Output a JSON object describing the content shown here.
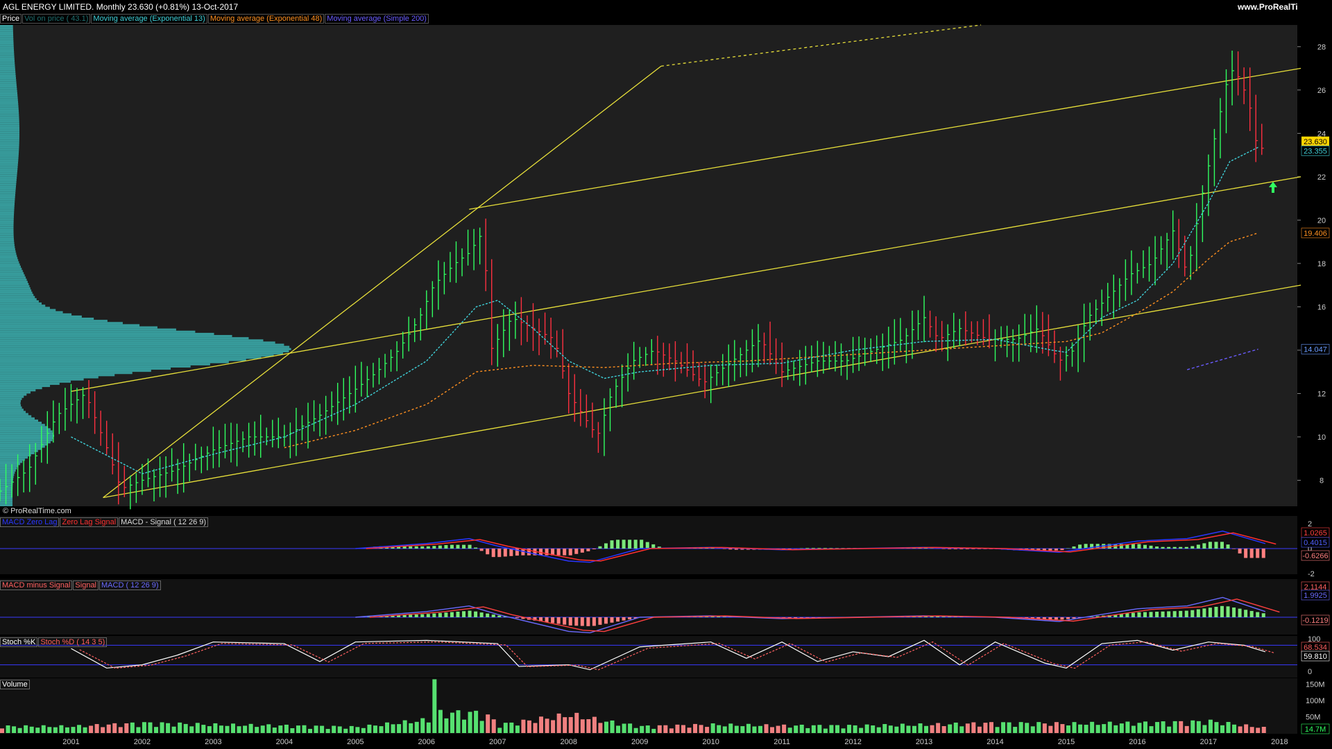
{
  "header": {
    "title": "AGL ENERGY LIMITED.   Monthly   23.630 (+0.81%)   13-Oct-2017",
    "brand": "www.ProRealTime.com",
    "copyright": "© ProRealTime.com"
  },
  "price_legend": [
    {
      "label": "Price",
      "color": "#ffffff"
    },
    {
      "label": "Vol on price ( 43.1)",
      "color": "#1f6f6f"
    },
    {
      "label": "Moving average (Exponential 13)",
      "color": "#3fd0d8"
    },
    {
      "label": "Moving average (Exponential 48)",
      "color": "#ff9020"
    },
    {
      "label": "Moving average (Simple 200)",
      "color": "#6a5cff"
    }
  ],
  "price_tags": [
    {
      "text": "23.630",
      "value": 23.63,
      "bg": "#ffd400",
      "fg": "#000"
    },
    {
      "text": "23.355",
      "value": 23.2,
      "bg": "#000",
      "fg": "#3fd0d8"
    },
    {
      "text": "19.406",
      "value": 19.406,
      "bg": "#000",
      "fg": "#ff9020"
    },
    {
      "text": "14.047",
      "value": 14.047,
      "bg": "#000",
      "fg": "#6a9cff"
    }
  ],
  "panel2": {
    "legend": [
      {
        "label": "MACD Zero Lag",
        "color": "#2a36ff"
      },
      {
        "label": "Zero Lag Signal",
        "color": "#ff3030"
      },
      {
        "label": "MACD - Signal ( 12 26 9)",
        "color": "#dddddd"
      }
    ],
    "ticks": [
      "2",
      "0",
      "-2"
    ],
    "tags": [
      {
        "text": "1.0265",
        "fg": "#ff4040"
      },
      {
        "text": "0.4015",
        "fg": "#5060ff"
      },
      {
        "text": "-0.6266",
        "fg": "#ff8080"
      }
    ]
  },
  "panel3": {
    "legend": [
      {
        "label": "MACD minus Signal",
        "color": "#ff6060"
      },
      {
        "label": "Signal",
        "color": "#ff6060"
      },
      {
        "label": "MACD ( 12 26 9)",
        "color": "#6a6aff"
      }
    ],
    "tags": [
      {
        "text": "2.1144",
        "fg": "#ff6060"
      },
      {
        "text": "1.9925",
        "fg": "#6a6aff"
      },
      {
        "text": "-0.1219",
        "fg": "#ff8080"
      }
    ]
  },
  "panel4": {
    "legend": [
      {
        "label": "Stoch %K",
        "color": "#ffffff"
      },
      {
        "label": "Stoch %D ( 14 3 5)",
        "color": "#ff6060"
      }
    ],
    "ticks": [
      "100",
      "0"
    ],
    "tags": [
      {
        "text": "68.534",
        "fg": "#ff6060"
      },
      {
        "text": "59.810",
        "fg": "#ffffff"
      }
    ]
  },
  "panel5": {
    "legend": [
      {
        "label": "Volume",
        "color": "#ffffff"
      }
    ],
    "ticks": [
      "150M",
      "100M",
      "50M"
    ],
    "tag": {
      "text": "14.7M",
      "fg": "#30ff60"
    }
  },
  "chart_data": {
    "type": "line",
    "title": "AGL ENERGY LIMITED.",
    "period": "Monthly",
    "ylim": [
      6.8,
      29
    ],
    "y_ticks": [
      8,
      10,
      12,
      14,
      16,
      18,
      20,
      22,
      24,
      26,
      28
    ],
    "x_labels": [
      "2001",
      "2002",
      "2003",
      "2004",
      "2005",
      "2006",
      "2007",
      "2008",
      "2009",
      "2010",
      "2011",
      "2012",
      "2013",
      "2014",
      "2015",
      "2016",
      "2017",
      "2018"
    ],
    "xlim": [
      2000.0,
      2018.25
    ],
    "series": [
      {
        "name": "Price",
        "style": "ohlc-bars",
        "colors": {
          "up": "#30ff60",
          "down": "#ff3040"
        },
        "x": [
          2000.0,
          2000.4,
          2000.8,
          2001.2,
          2001.5,
          2001.7,
          2002.0,
          2002.5,
          2003.0,
          2003.5,
          2004.0,
          2004.5,
          2005.0,
          2005.3,
          2005.6,
          2005.9,
          2006.1,
          2006.4,
          2006.6,
          2006.8,
          2006.9,
          2007.2,
          2007.5,
          2007.8,
          2008.0,
          2008.2,
          2008.4,
          2008.6,
          2008.9,
          2009.2,
          2009.5,
          2009.9,
          2010.3,
          2010.7,
          2011.0,
          2011.5,
          2011.9,
          2012.3,
          2012.7,
          2013.0,
          2013.2,
          2013.5,
          2013.9,
          2014.3,
          2014.6,
          2014.9,
          2015.1,
          2015.3,
          2015.6,
          2015.9,
          2016.2,
          2016.5,
          2016.7,
          2016.9,
          2017.1,
          2017.3,
          2017.45,
          2017.6,
          2017.7,
          2017.8
        ],
        "values": [
          7.5,
          8.5,
          11.0,
          12.0,
          9.5,
          7.6,
          8.0,
          8.5,
          9.4,
          10.0,
          10.0,
          11.0,
          12.2,
          13.0,
          14.0,
          15.5,
          17.0,
          18.0,
          18.5,
          19.5,
          14.0,
          15.5,
          15.0,
          14.5,
          12.0,
          11.0,
          10.0,
          12.0,
          13.5,
          14.0,
          13.5,
          12.5,
          13.5,
          14.5,
          13.0,
          13.5,
          13.5,
          14.0,
          14.5,
          15.5,
          14.5,
          15.0,
          14.5,
          14.5,
          15.0,
          13.5,
          14.0,
          15.5,
          16.5,
          17.5,
          18.0,
          19.5,
          17.5,
          21.0,
          24.0,
          27.0,
          26.5,
          25.0,
          23.0,
          23.63
        ]
      },
      {
        "name": "Moving average (Exponential 13)",
        "color": "#3fd0d8",
        "x": [
          2001.0,
          2002.0,
          2003.0,
          2004.0,
          2005.0,
          2006.0,
          2006.7,
          2007.0,
          2007.5,
          2008.0,
          2008.5,
          2009.0,
          2010.0,
          2011.0,
          2012.0,
          2013.0,
          2014.0,
          2014.8,
          2015.0,
          2015.5,
          2016.0,
          2016.5,
          2017.0,
          2017.3,
          2017.7
        ],
        "values": [
          10.0,
          8.3,
          9.2,
          10.0,
          11.5,
          13.5,
          16.0,
          16.3,
          15.0,
          13.5,
          12.7,
          13.0,
          13.3,
          13.4,
          14.0,
          14.4,
          14.5,
          14.0,
          13.9,
          15.5,
          16.3,
          18.0,
          20.8,
          22.7,
          23.36
        ]
      },
      {
        "name": "Moving average (Exponential 48)",
        "color": "#ff9020",
        "x": [
          2004.0,
          2005.0,
          2006.0,
          2006.7,
          2007.5,
          2008.5,
          2009.5,
          2010.5,
          2011.5,
          2012.5,
          2013.5,
          2014.5,
          2015.0,
          2015.5,
          2016.0,
          2016.5,
          2017.0,
          2017.3,
          2017.7
        ],
        "values": [
          9.5,
          10.3,
          11.5,
          13.0,
          13.3,
          13.2,
          13.4,
          13.5,
          13.7,
          13.9,
          14.1,
          14.3,
          14.4,
          14.8,
          15.7,
          16.7,
          18.2,
          19.0,
          19.406
        ]
      },
      {
        "name": "Moving average (Simple 200)",
        "color": "#6a5cff",
        "x": [
          2016.7,
          2017.7
        ],
        "values": [
          13.1,
          14.047
        ]
      }
    ],
    "volume_profile_note": "Vol on price horizontal histogram at left",
    "trendlines": [
      {
        "from": [
          2001.45,
          7.2
        ],
        "to": [
          2018.3,
          17.0
        ]
      },
      {
        "from": [
          2001.0,
          12.1
        ],
        "to": [
          2018.3,
          22.0
        ]
      },
      {
        "from": [
          2006.6,
          20.5
        ],
        "to": [
          2018.3,
          27.0
        ]
      },
      {
        "from": [
          2001.45,
          7.2
        ],
        "to": [
          2009.3,
          27.1
        ]
      }
    ],
    "macd_zero_lag": {
      "x": [
        2005.0,
        2006.0,
        2006.6,
        2007.0,
        2008.0,
        2008.3,
        2009.0,
        2010.0,
        2011.0,
        2012.0,
        2013.0,
        2014.0,
        2014.9,
        2015.5,
        2016.0,
        2016.7,
        2017.2,
        2017.8
      ],
      "values": [
        0,
        0.4,
        0.8,
        0.2,
        -1.0,
        -1.1,
        0.0,
        0.1,
        -0.1,
        0.0,
        0.1,
        0.0,
        -0.3,
        0.2,
        0.6,
        0.8,
        1.4,
        0.4
      ]
    },
    "stoch_k": {
      "x": [
        2001.0,
        2001.5,
        2002.0,
        2002.5,
        2003.0,
        2004.0,
        2004.5,
        2005.0,
        2006.0,
        2007.0,
        2007.3,
        2008.0,
        2008.3,
        2009.0,
        2010.0,
        2010.5,
        2011.0,
        2011.5,
        2012.0,
        2012.5,
        2013.0,
        2013.5,
        2014.0,
        2014.7,
        2015.0,
        2015.5,
        2016.0,
        2016.5,
        2017.0,
        2017.5,
        2017.8
      ],
      "values": [
        70,
        10,
        20,
        50,
        90,
        85,
        30,
        90,
        95,
        85,
        15,
        20,
        5,
        75,
        90,
        40,
        90,
        30,
        60,
        45,
        95,
        20,
        90,
        25,
        10,
        85,
        95,
        65,
        90,
        80,
        60
      ]
    },
    "volume": {
      "x": [
        2001,
        2002,
        2003,
        2004,
        2005,
        2006.0,
        2006.1,
        2007,
        2008,
        2008.5,
        2009,
        2010,
        2011,
        2012,
        2013,
        2014,
        2015,
        2016,
        2017,
        2017.8
      ],
      "values": [
        20,
        30,
        25,
        22,
        18,
        40,
        165,
        25,
        55,
        35,
        20,
        25,
        22,
        22,
        25,
        30,
        28,
        30,
        35,
        14.7
      ]
    }
  }
}
